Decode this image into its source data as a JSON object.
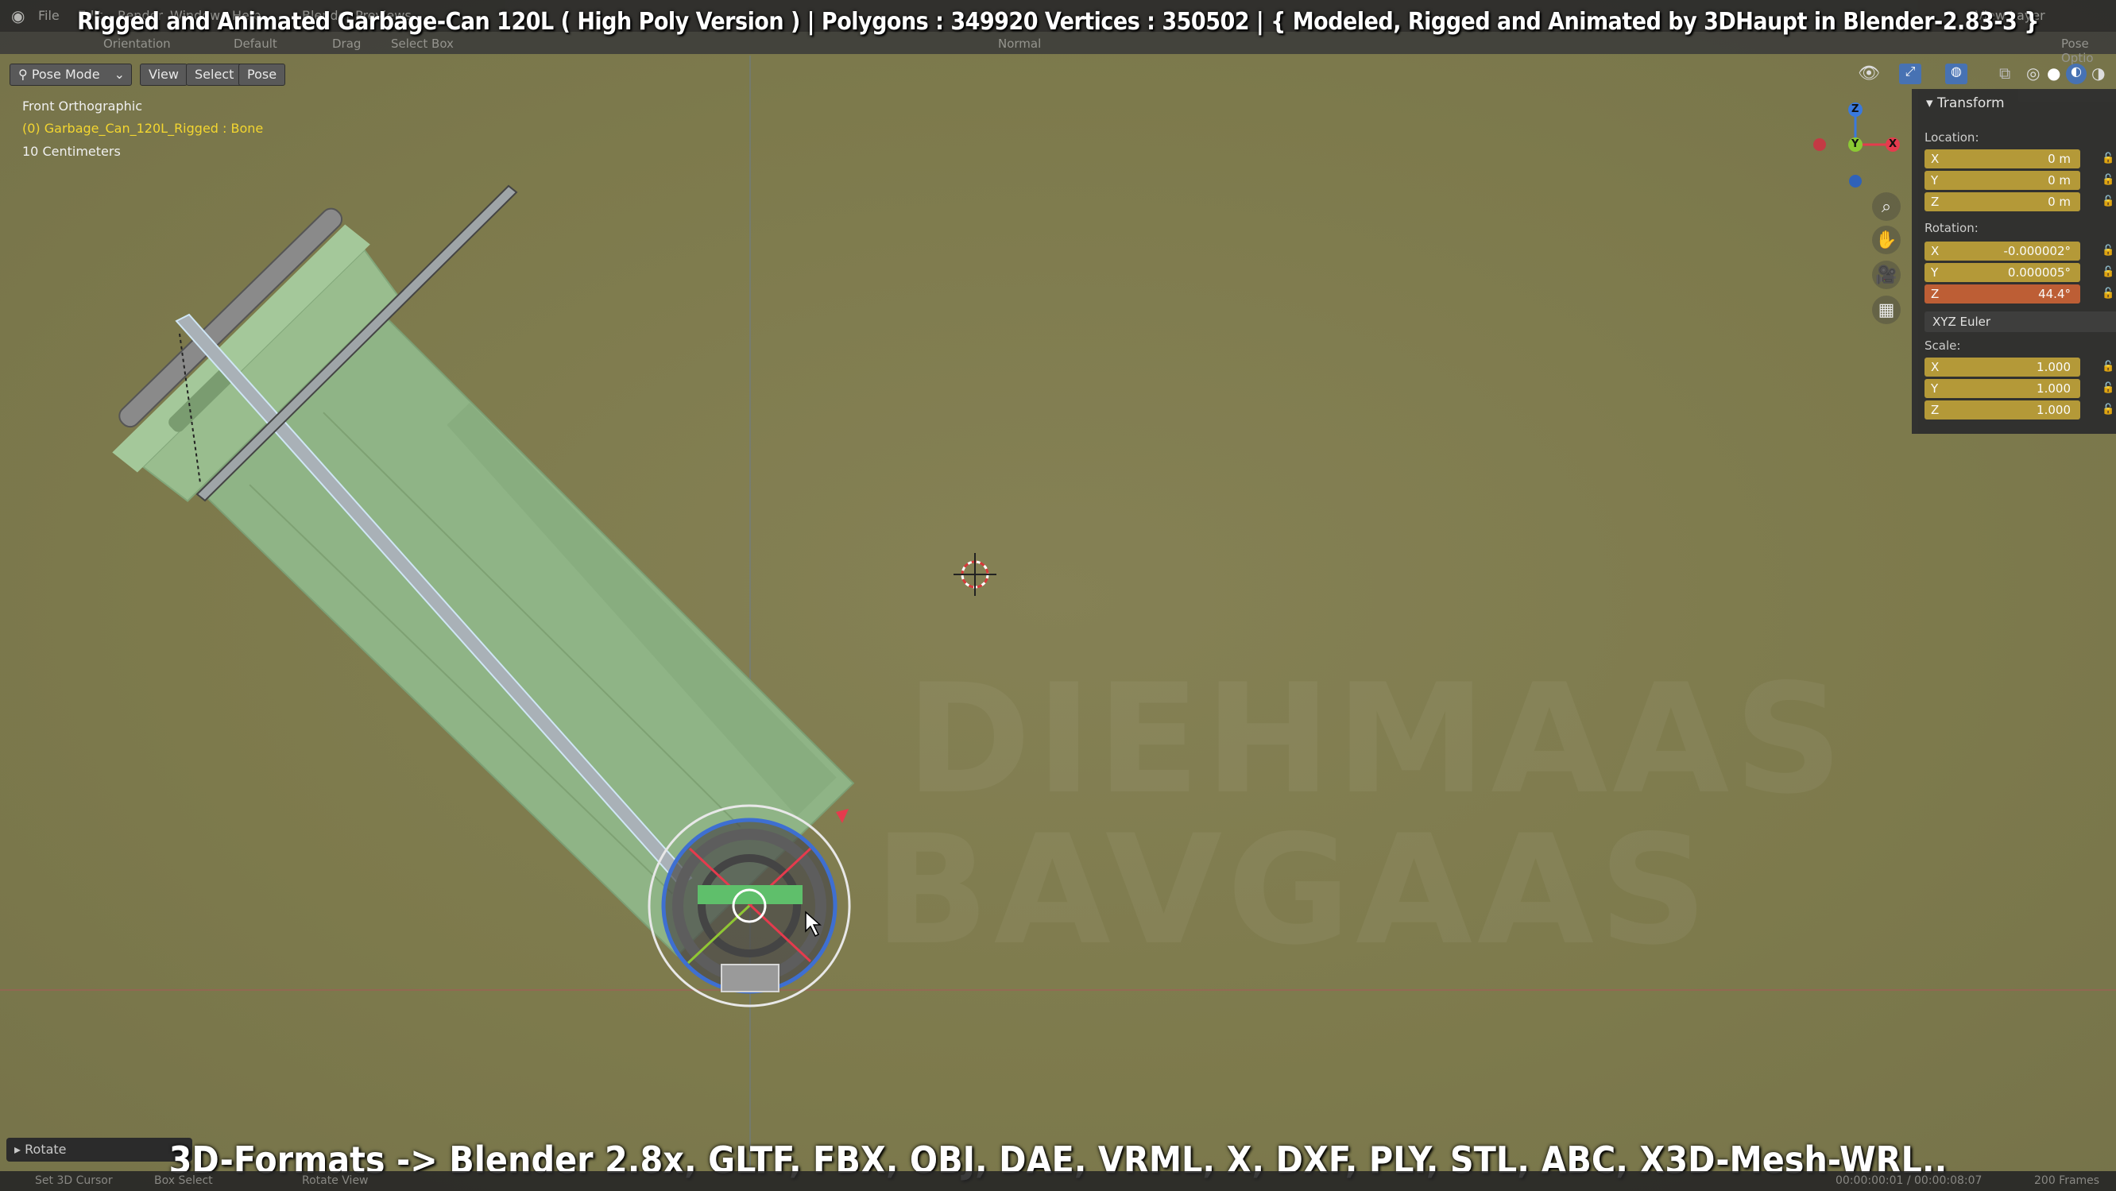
{
  "topbar": {
    "menu": [
      "File",
      "Edit",
      "Render",
      "Window",
      "Help"
    ],
    "workspace_tab": "Blender Previews",
    "orientation_label": "Orientation",
    "default_label": "Default",
    "drag_label": "Drag",
    "select_box_label": "Select Box",
    "normal_label": "Normal",
    "view_layer_label": "View Layer",
    "pose_options_label": "Pose Optio"
  },
  "title_overlay": "Rigged and Animated Garbage-Can 120L ( High Poly Version )  |  Polygons : 349920  Vertices : 350502   |  { Modeled, Rigged and Animated by 3DHaupt in Blender-2.83-3 }",
  "header": {
    "mode": "Pose Mode",
    "view": "View",
    "select": "Select",
    "pose": "Pose"
  },
  "viewport_info": {
    "view_name": "Front Orthographic",
    "active_object": "(0) Garbage_Can_120L_Rigged : Bone",
    "scale": "10 Centimeters"
  },
  "gizmo": {
    "z": "Z",
    "y": "Y",
    "x": "X",
    "colors": {
      "x": "#e53b4d",
      "y": "#8bc934",
      "z": "#3a79dd"
    }
  },
  "transform_panel": {
    "title": "Transform",
    "location_label": "Location:",
    "location": [
      {
        "axis": "X",
        "value": "0 m"
      },
      {
        "axis": "Y",
        "value": "0 m"
      },
      {
        "axis": "Z",
        "value": "0 m"
      }
    ],
    "rotation_label": "Rotation:",
    "rotation": [
      {
        "axis": "X",
        "value": "-0.000002°"
      },
      {
        "axis": "Y",
        "value": "0.000005°"
      },
      {
        "axis": "Z",
        "value": "44.4°"
      }
    ],
    "rotation_mode": "XYZ Euler",
    "scale_label": "Scale:",
    "scale": [
      {
        "axis": "X",
        "value": "1.000"
      },
      {
        "axis": "Y",
        "value": "1.000"
      },
      {
        "axis": "Z",
        "value": "1.000"
      }
    ]
  },
  "operator_panel": {
    "label": "Rotate"
  },
  "footer_overlay": "3D-Formats -> Blender 2.8x, GLTF, FBX, OBJ, DAE, VRML, X, DXF, PLY, STL, ABC, X3D-Mesh-WRL..",
  "statusbar": {
    "left1": "Set 3D Cursor",
    "left2": "Box Select",
    "left3": "Rotate View",
    "right_time": "00:00:00:01 / 00:00:08:07",
    "right_frames": "200 Frames"
  },
  "colors": {
    "viewport_bg": "#7f7b4e",
    "can_body": "#8fb486",
    "panel_field": "#b69b38",
    "panel_field_active": "#c05e35"
  }
}
